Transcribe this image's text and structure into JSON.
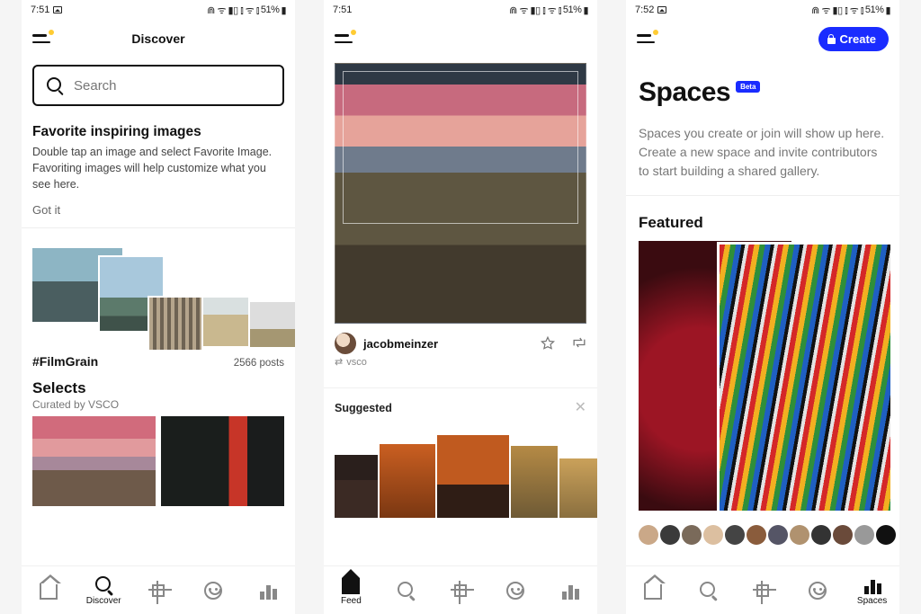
{
  "status": {
    "t1": "7:51",
    "t2": "7:51",
    "t3": "7:52",
    "right": "51%"
  },
  "discover": {
    "title": "Discover",
    "search_placeholder": "Search",
    "info_title": "Favorite inspiring images",
    "info_body": "Double tap an image and select Favorite Image. Favoriting images will help customize what you see here.",
    "gotit": "Got it",
    "hashtag": "#FilmGrain",
    "post_count": "2566 posts",
    "selects_title": "Selects",
    "selects_sub": "Curated by VSCO"
  },
  "feed": {
    "username": "jacobmeinzer",
    "reposted_label": "vsco",
    "suggested_label": "Suggested"
  },
  "spaces": {
    "create_label": "Create",
    "title": "Spaces",
    "beta": "Beta",
    "desc": "Spaces you create or join will show up here. Create a new space and invite contributors to start building a shared gallery.",
    "featured": "Featured"
  },
  "nav": {
    "discover": "Discover",
    "feed": "Feed",
    "spaces": "Spaces"
  }
}
